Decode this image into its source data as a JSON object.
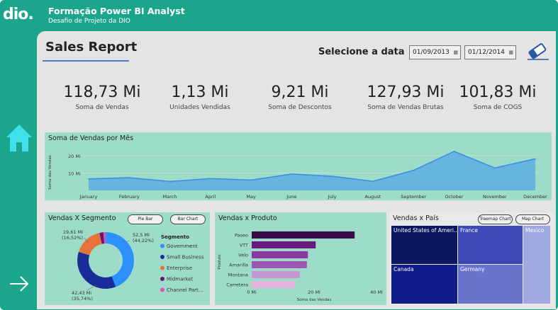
{
  "app": {
    "logo": "dio.",
    "title": "Formação Power BI Analyst",
    "subtitle": "Desafio de Projeto da DIO"
  },
  "report": {
    "title": "Sales Report",
    "date_label": "Selecione a data",
    "date_start": "01/09/2013",
    "date_end": "01/12/2014"
  },
  "kpis": [
    {
      "value": "118,73 Mi",
      "label": "Soma de Vendas"
    },
    {
      "value": "1,13 Mi",
      "label": "Unidades Vendidas"
    },
    {
      "value": "9,21 Mi",
      "label": "Soma de Descontos"
    },
    {
      "value": "127,93 Mi",
      "label": "Soma de Vendas Brutas"
    },
    {
      "value": "101,83 Mi",
      "label": "Soma de COGS"
    }
  ],
  "colors": {
    "accent": "#1ba58c",
    "panel": "#9ddcc8",
    "canvas": "#e4e4e4",
    "line": "#3d8fe0",
    "area": "#62afe0"
  },
  "chart_data": [
    {
      "type": "area",
      "title": "Soma de Vendas por Mês",
      "ylabel": "Soma das Vendas",
      "xlabel": "",
      "categories": [
        "January",
        "February",
        "March",
        "April",
        "May",
        "June",
        "July",
        "August",
        "September",
        "October",
        "November",
        "December"
      ],
      "y_ticks": [
        "10 Mi",
        "20 Mi"
      ],
      "ylim": [
        0,
        26
      ],
      "series": [
        {
          "values": [
            6.6,
            7.3,
            5.1,
            6.8,
            5.9,
            9.4,
            8.1,
            5.2,
            11.5,
            22.4,
            12.9,
            18.1
          ]
        }
      ]
    },
    {
      "type": "pie",
      "title": "Vendas X Segmento",
      "legend_title": "Segmento",
      "buttons": [
        "Pie Bar",
        "Bar Chart"
      ],
      "slices": [
        {
          "name": "Government",
          "value": 52.5,
          "label": "52,5 Mi",
          "pct": "(44,22%)",
          "color": "#2e8fff"
        },
        {
          "name": "Small Business",
          "value": 42.43,
          "label": "42,43 Mi",
          "pct": "(35,74%)",
          "color": "#1a2c9a"
        },
        {
          "name": "Enterprise",
          "value": 19.61,
          "label": "19,61 Mi",
          "pct": "(16,52%)",
          "color": "#e8733a"
        },
        {
          "name": "Midmarket",
          "value": 2.7,
          "label": "",
          "pct": "",
          "color": "#6a127a"
        },
        {
          "name": "Channel Part...",
          "value": 1.5,
          "label": "",
          "pct": "",
          "color": "#e055b8"
        }
      ]
    },
    {
      "type": "bar",
      "orientation": "horizontal",
      "title": "Vendas x Produto",
      "ylabel": "Produto",
      "xlabel": "Soma das Vendas",
      "categories": [
        "Paseo",
        "VTT",
        "Velo",
        "Amarilla",
        "Montana",
        "Carretera"
      ],
      "values": [
        33.0,
        20.5,
        18.0,
        17.7,
        15.4,
        13.8
      ],
      "colors": [
        "#3a0a4a",
        "#6a1a7e",
        "#8b39a2",
        "#9f57b4",
        "#c695d2",
        "#e5b5e0"
      ],
      "x_ticks": [
        "0 Mi",
        "20 Mi",
        "40 Mi"
      ],
      "xlim": [
        0,
        40
      ]
    },
    {
      "type": "treemap",
      "title": "Vendas x País",
      "buttons": [
        "Treemap Chart",
        "Map Chart"
      ],
      "cells": [
        {
          "name": "United States of Ameri...",
          "color": "#0c1560"
        },
        {
          "name": "France",
          "color": "#3e48b6"
        },
        {
          "name": "Mexico",
          "color": "#9fa8e0"
        },
        {
          "name": "Canada",
          "color": "#101d88"
        },
        {
          "name": "Germany",
          "color": "#6873cc"
        }
      ]
    }
  ]
}
